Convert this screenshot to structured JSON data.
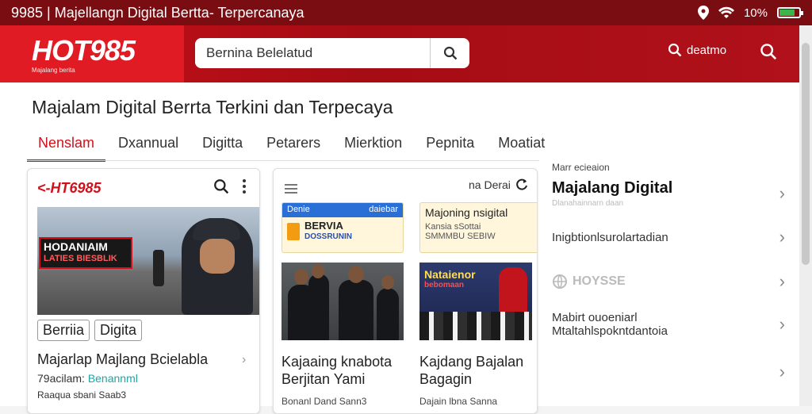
{
  "statusbar": {
    "title": "9985 | Majellangn Digital Bertta- Terpercanaya",
    "battery_text": "10%",
    "battery_level": 0.8
  },
  "header": {
    "logo": "HOT985",
    "logo_tagline": "Majalang berita",
    "search_value": "Bernina Belelatud",
    "search_link": "deatmo"
  },
  "page": {
    "title": "Majalam Digital Berrta Terkini dan Terpecaya",
    "tabs": [
      "Nenslam",
      "Dxannual",
      "Digitta",
      "Petarers",
      "Mierktion",
      "Pepnita",
      "Moatiat"
    ],
    "active_tab": 0
  },
  "card1": {
    "logo": "HT6985",
    "overlay_line1": "HODANIAIM",
    "overlay_line2": "LATIES BIESBLIK",
    "chips": [
      "Berriia",
      "Digita"
    ],
    "headline": "Majarlap Majlang Bcielabla",
    "meta_prefix": "79acilam:",
    "meta_highlight": "Benannml",
    "meta2": "Raaqua sbani Saab3"
  },
  "card2": {
    "topright": "na Derai",
    "sub1_bar_left": "Denie",
    "sub1_bar_right": "daiebar",
    "sub1_title": "BERVIA",
    "sub1_sub": "DOSSRUNIN",
    "sub2_title": "Majoning nsigital",
    "sub2_line1": "Kansia sSottai",
    "sub2_line2": "SMMMBU SEBIW",
    "photo3_banner": "Nataienor",
    "photo3_sub": "bebomaan",
    "headline1": "Kajaaing knabota Berjitan Yami",
    "headline2": "Kajdang Bajalan Bagagin",
    "footer1": "Bonanl Dand Sann3",
    "footer2": "Dajain lbna Sanna"
  },
  "sidebar": {
    "label": "Marr ecieaion",
    "items": [
      {
        "title": "Majalang Digital",
        "sub": "Dlanahainnarn daan"
      },
      {
        "title": "Inigbtionlsurolartadian"
      },
      {
        "title": "HOYSSE"
      },
      {
        "title": "Mabirt ouoeniarl",
        "sub": "Mtaltahlspokntdantoia"
      },
      {
        "title": ""
      }
    ]
  },
  "colors": {
    "brand_red": "#d0111b",
    "status_bar": "#7a0d12"
  }
}
